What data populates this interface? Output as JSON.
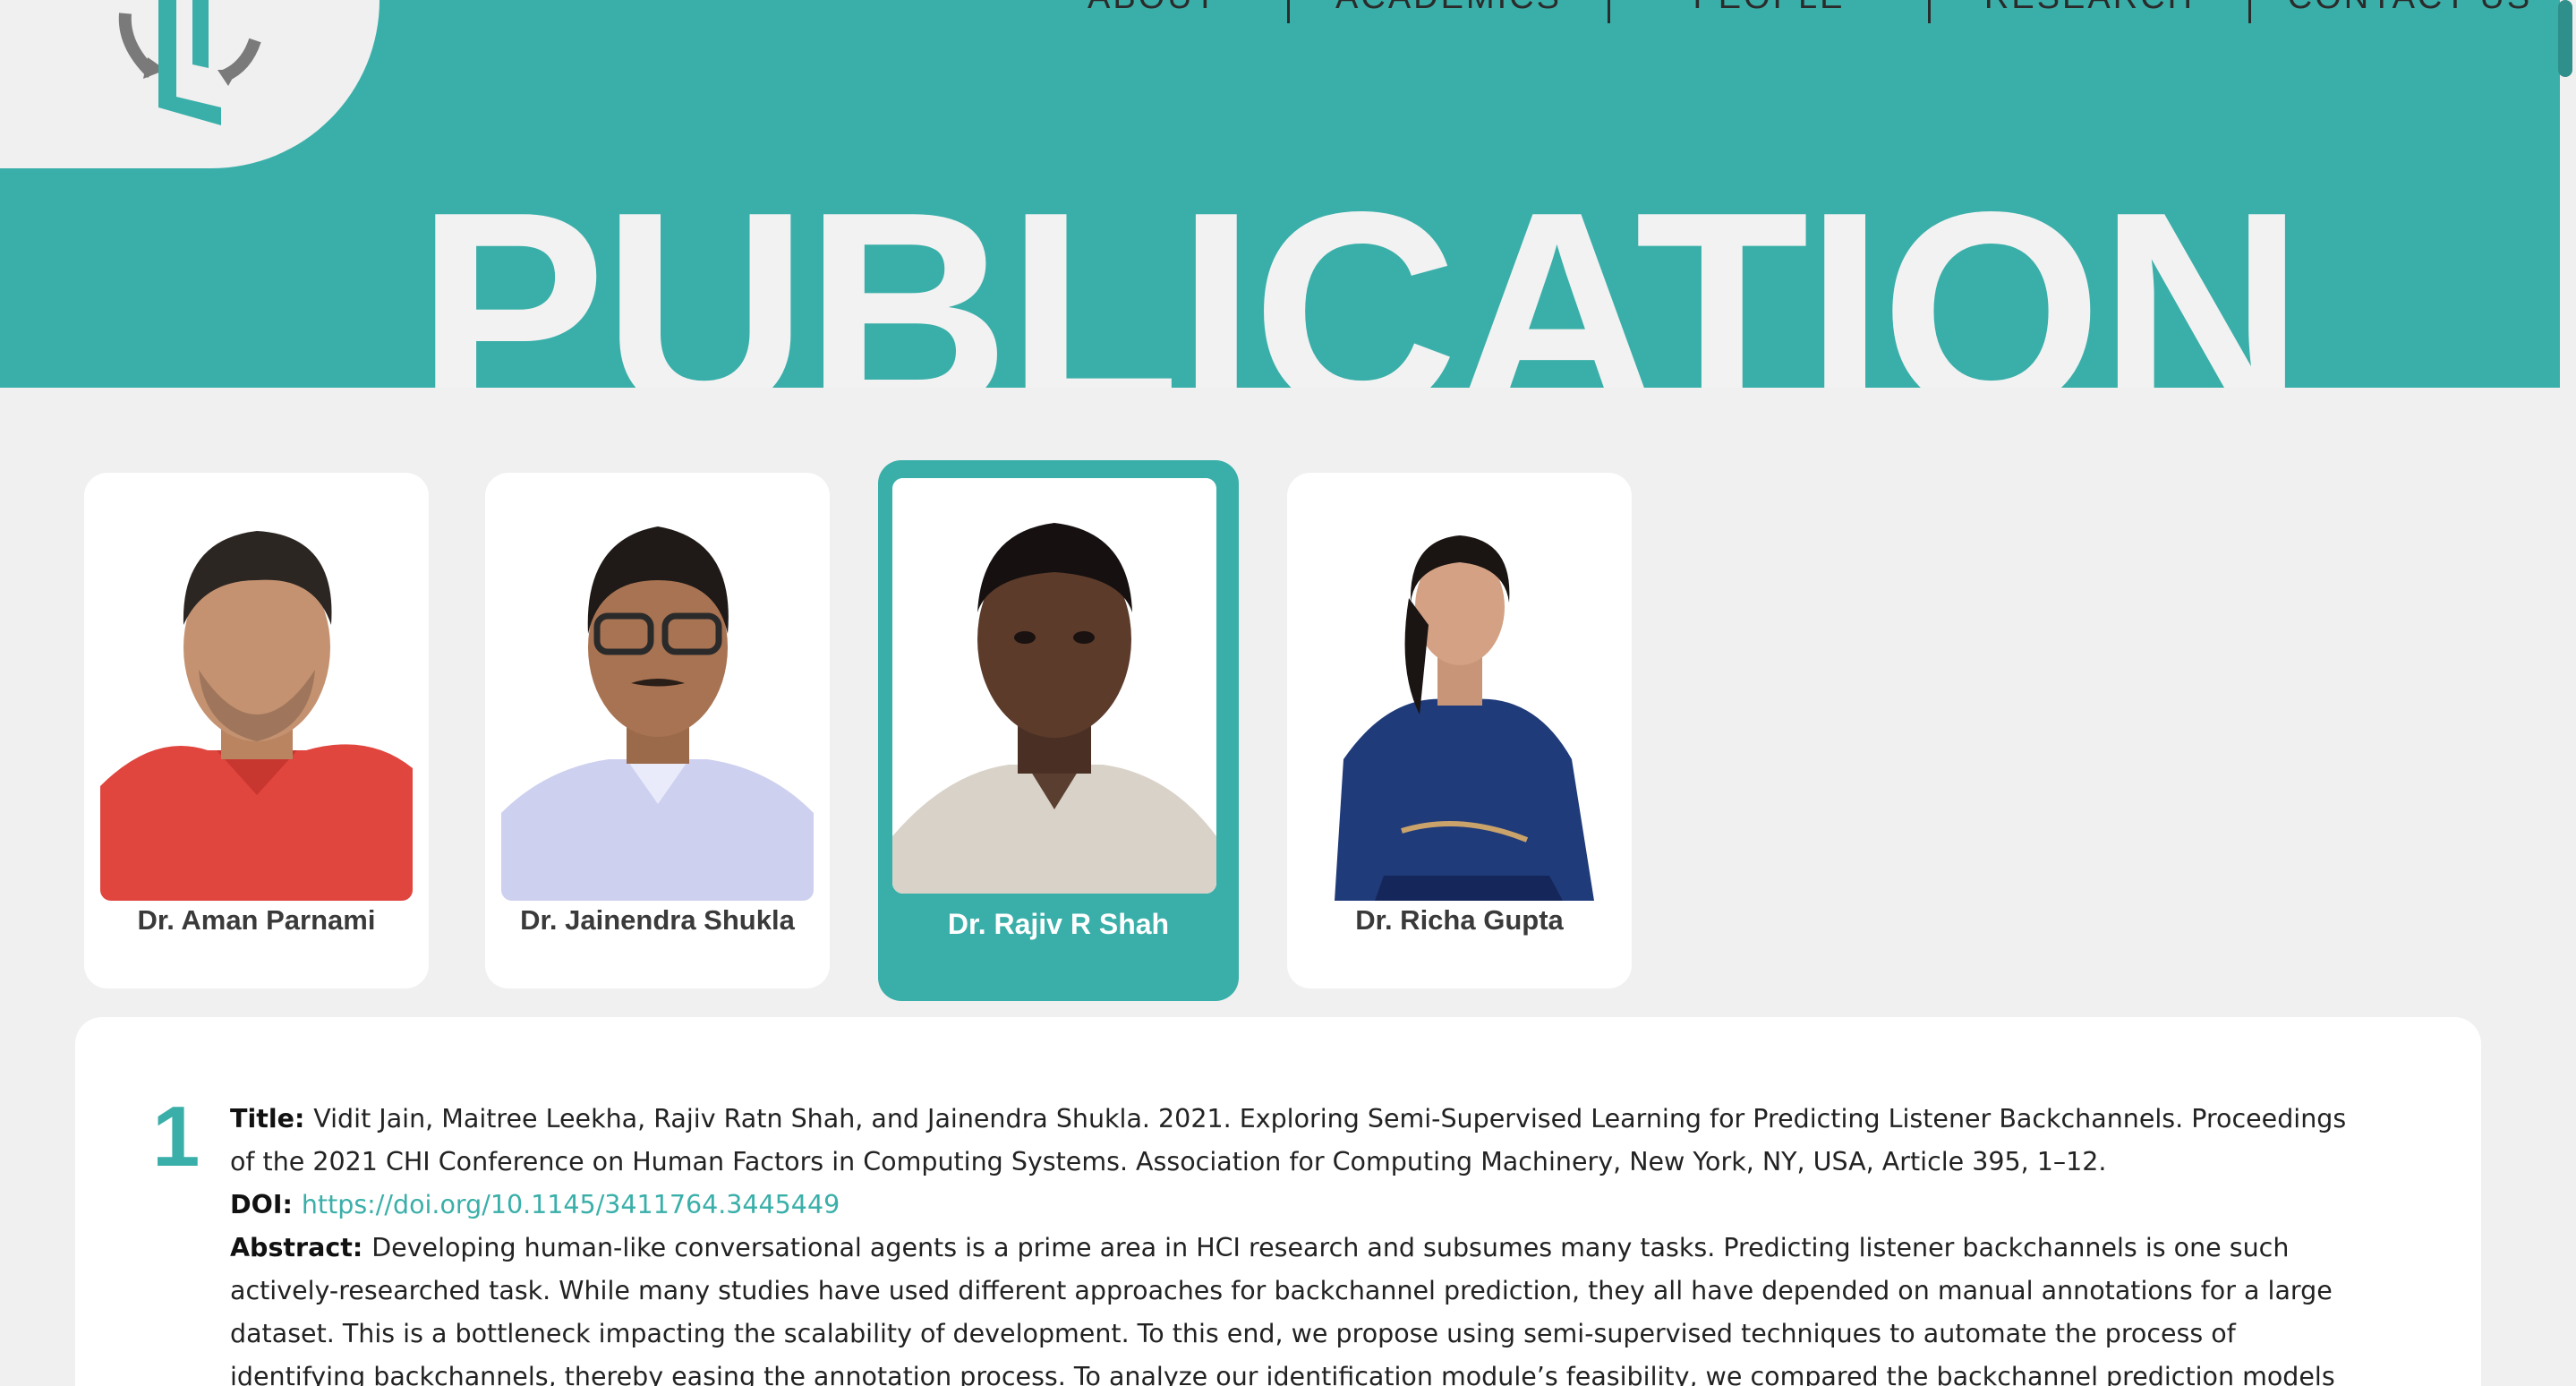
{
  "colors": {
    "accent": "#3aafa9",
    "page_background": "#f0f0f0",
    "card_background": "#ffffff",
    "title_text": "#f2f2f2"
  },
  "header": {
    "logo_icon": "university-logo-icon",
    "nav": [
      "ABOUT",
      "ACADEMICS",
      "PEOPLE",
      "RESEARCH",
      "CONTACT US"
    ],
    "hero_title": "PUBLICATION"
  },
  "faculty": [
    {
      "name": "Dr. Aman Parnami",
      "selected": false
    },
    {
      "name": "Dr. Jainendra Shukla",
      "selected": false
    },
    {
      "name": "Dr. Rajiv R Shah",
      "selected": true
    },
    {
      "name": "Dr. Richa Gupta",
      "selected": false
    }
  ],
  "publication": {
    "number": "1",
    "title_label": "Title",
    "title_lines": [
      "Vidit Jain, Maitree Leekha, Rajiv Ratn Shah, and Jainendra Shukla. 2021. Exploring Semi-Supervised Learning for Predicting Listener Backchannels. Proceedings",
      "of the 2021 CHI Conference on Human Factors in Computing Systems. Association for Computing Machinery, New York, NY, USA, Article 395, 1–12."
    ],
    "doi_label": "DOI",
    "doi_link": "https://doi.org/10.1145/3411764.3445449",
    "abstract_label": "Abstract",
    "abstract_lines": [
      "Developing human-like conversational agents is a prime area in HCI research and subsumes many tasks. Predicting listener backchannels is one such",
      "actively-researched task. While many studies have used different approaches for backchannel prediction, they all have depended on manual annotations for a large",
      "dataset. This is a bottleneck impacting the scalability of development. To this end, we propose using semi-supervised techniques to automate the process of",
      "identifying backchannels, thereby easing the annotation process. To analyze our identification module’s feasibility, we compared the backchannel prediction models"
    ]
  }
}
